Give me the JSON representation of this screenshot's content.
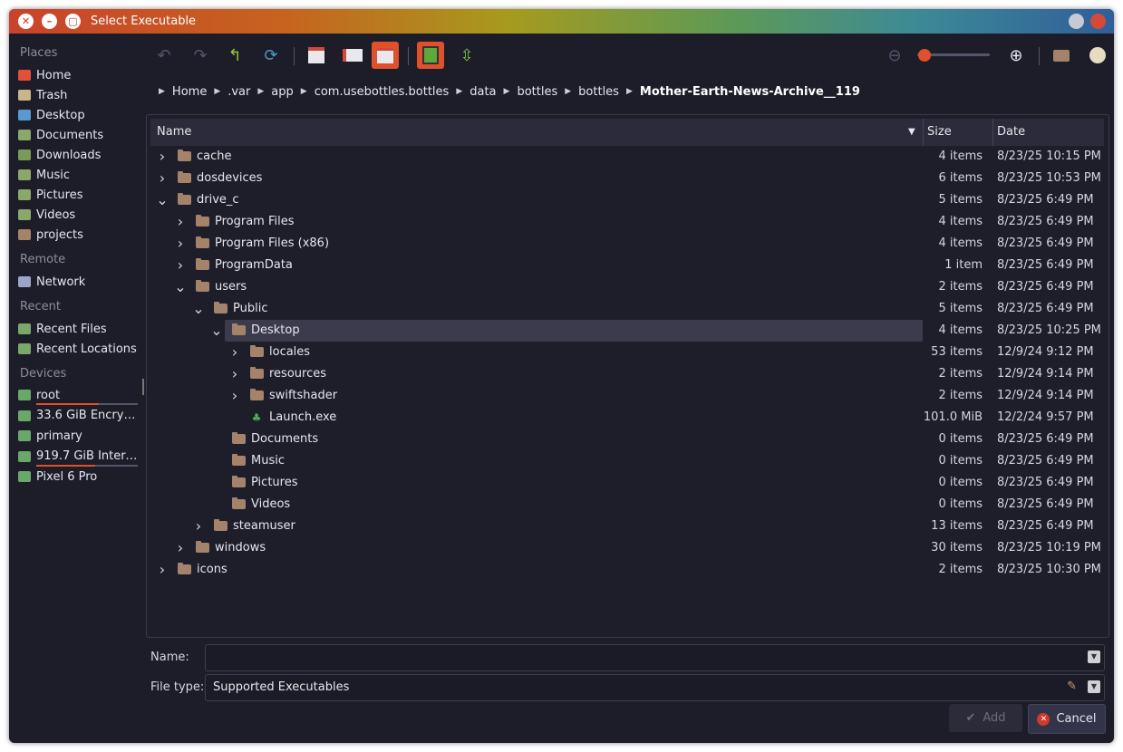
{
  "window": {
    "title": "Select Executable"
  },
  "sidebar": {
    "sections": {
      "places": "Places",
      "remote": "Remote",
      "recent": "Recent",
      "devices": "Devices"
    },
    "places": [
      "Home",
      "Trash",
      "Desktop",
      "Documents",
      "Downloads",
      "Music",
      "Pictures",
      "Videos",
      "projects"
    ],
    "remote": [
      "Network"
    ],
    "recent": [
      "Recent Files",
      "Recent Locations"
    ],
    "devices": [
      "root",
      "33.6 GiB Encrypt...",
      "primary",
      "919.7 GiB Intern...",
      "Pixel 6 Pro"
    ],
    "device_usage": {
      "root": 0.62,
      "internal": 0.58
    }
  },
  "toolbar": {
    "zoom_level": 0.1
  },
  "breadcrumb": [
    "Home",
    ".var",
    "app",
    "com.usebottles.bottles",
    "data",
    "bottles",
    "bottles",
    "Mother-Earth-News-Archive__119"
  ],
  "columns": {
    "name": "Name",
    "size": "Size",
    "date": "Date"
  },
  "rows": [
    {
      "name": "cache",
      "size": "4 items",
      "date": "8/23/25 10:15 PM"
    },
    {
      "name": "dosdevices",
      "size": "6 items",
      "date": "8/23/25 10:53 PM"
    },
    {
      "name": "drive_c",
      "size": "5 items",
      "date": "8/23/25 6:49 PM"
    },
    {
      "name": "Program Files",
      "size": "4 items",
      "date": "8/23/25 6:49 PM"
    },
    {
      "name": "Program Files (x86)",
      "size": "4 items",
      "date": "8/23/25 6:49 PM"
    },
    {
      "name": "ProgramData",
      "size": "1 item",
      "date": "8/23/25 6:49 PM"
    },
    {
      "name": "users",
      "size": "2 items",
      "date": "8/23/25 6:49 PM"
    },
    {
      "name": "Public",
      "size": "5 items",
      "date": "8/23/25 6:49 PM"
    },
    {
      "name": "Desktop",
      "size": "4 items",
      "date": "8/23/25 10:25 PM"
    },
    {
      "name": "locales",
      "size": "53 items",
      "date": "12/9/24 9:12 PM"
    },
    {
      "name": "resources",
      "size": "2 items",
      "date": "12/9/24 9:14 PM"
    },
    {
      "name": "swiftshader",
      "size": "2 items",
      "date": "12/9/24 9:14 PM"
    },
    {
      "name": "Launch.exe",
      "size": "101.0 MiB",
      "date": "12/2/24 9:57 PM"
    },
    {
      "name": "Documents",
      "size": "0 items",
      "date": "8/23/25 6:49 PM"
    },
    {
      "name": "Music",
      "size": "0 items",
      "date": "8/23/25 6:49 PM"
    },
    {
      "name": "Pictures",
      "size": "0 items",
      "date": "8/23/25 6:49 PM"
    },
    {
      "name": "Videos",
      "size": "0 items",
      "date": "8/23/25 6:49 PM"
    },
    {
      "name": "steamuser",
      "size": "13 items",
      "date": "8/23/25 6:49 PM"
    },
    {
      "name": "windows",
      "size": "30 items",
      "date": "8/23/25 10:19 PM"
    },
    {
      "name": "icons",
      "size": "2 items",
      "date": "8/23/25 10:30 PM"
    }
  ],
  "form": {
    "name_label": "Name:",
    "name_value": "",
    "filetype_label": "File type:",
    "filetype_value": "Supported Executables"
  },
  "buttons": {
    "add": "Add",
    "cancel": "Cancel"
  },
  "colors": {
    "accent": "#e0502a",
    "selection": "#3b3b4d",
    "folder": "#a5826a"
  }
}
